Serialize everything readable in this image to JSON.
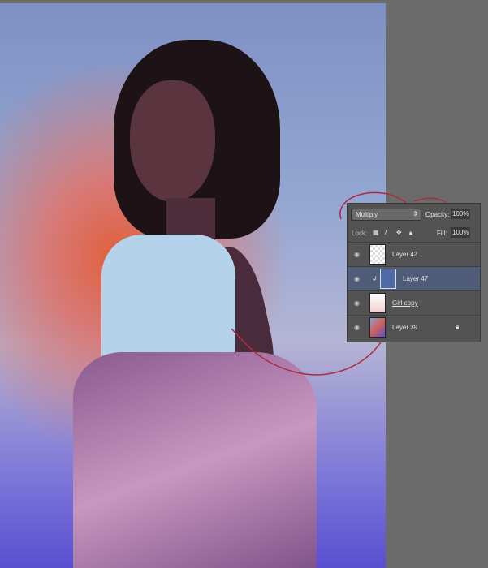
{
  "layers_panel": {
    "blend_mode": "Multiply",
    "opacity_label": "Opacity:",
    "opacity_value": "100%",
    "lock_label": "Lock:",
    "fill_label": "Fill:",
    "fill_value": "100%",
    "layers": [
      {
        "name": "Layer 42",
        "selected": false
      },
      {
        "name": "Layer 47",
        "selected": true,
        "clipped": true
      },
      {
        "name": "Girl copy",
        "selected": false
      },
      {
        "name": "Layer 39",
        "selected": false,
        "locked": true
      }
    ]
  },
  "colors": {
    "selected_row": "#4f5d78",
    "annotation": "#b02a3c",
    "layer47_fill": "#4f6aa5"
  }
}
